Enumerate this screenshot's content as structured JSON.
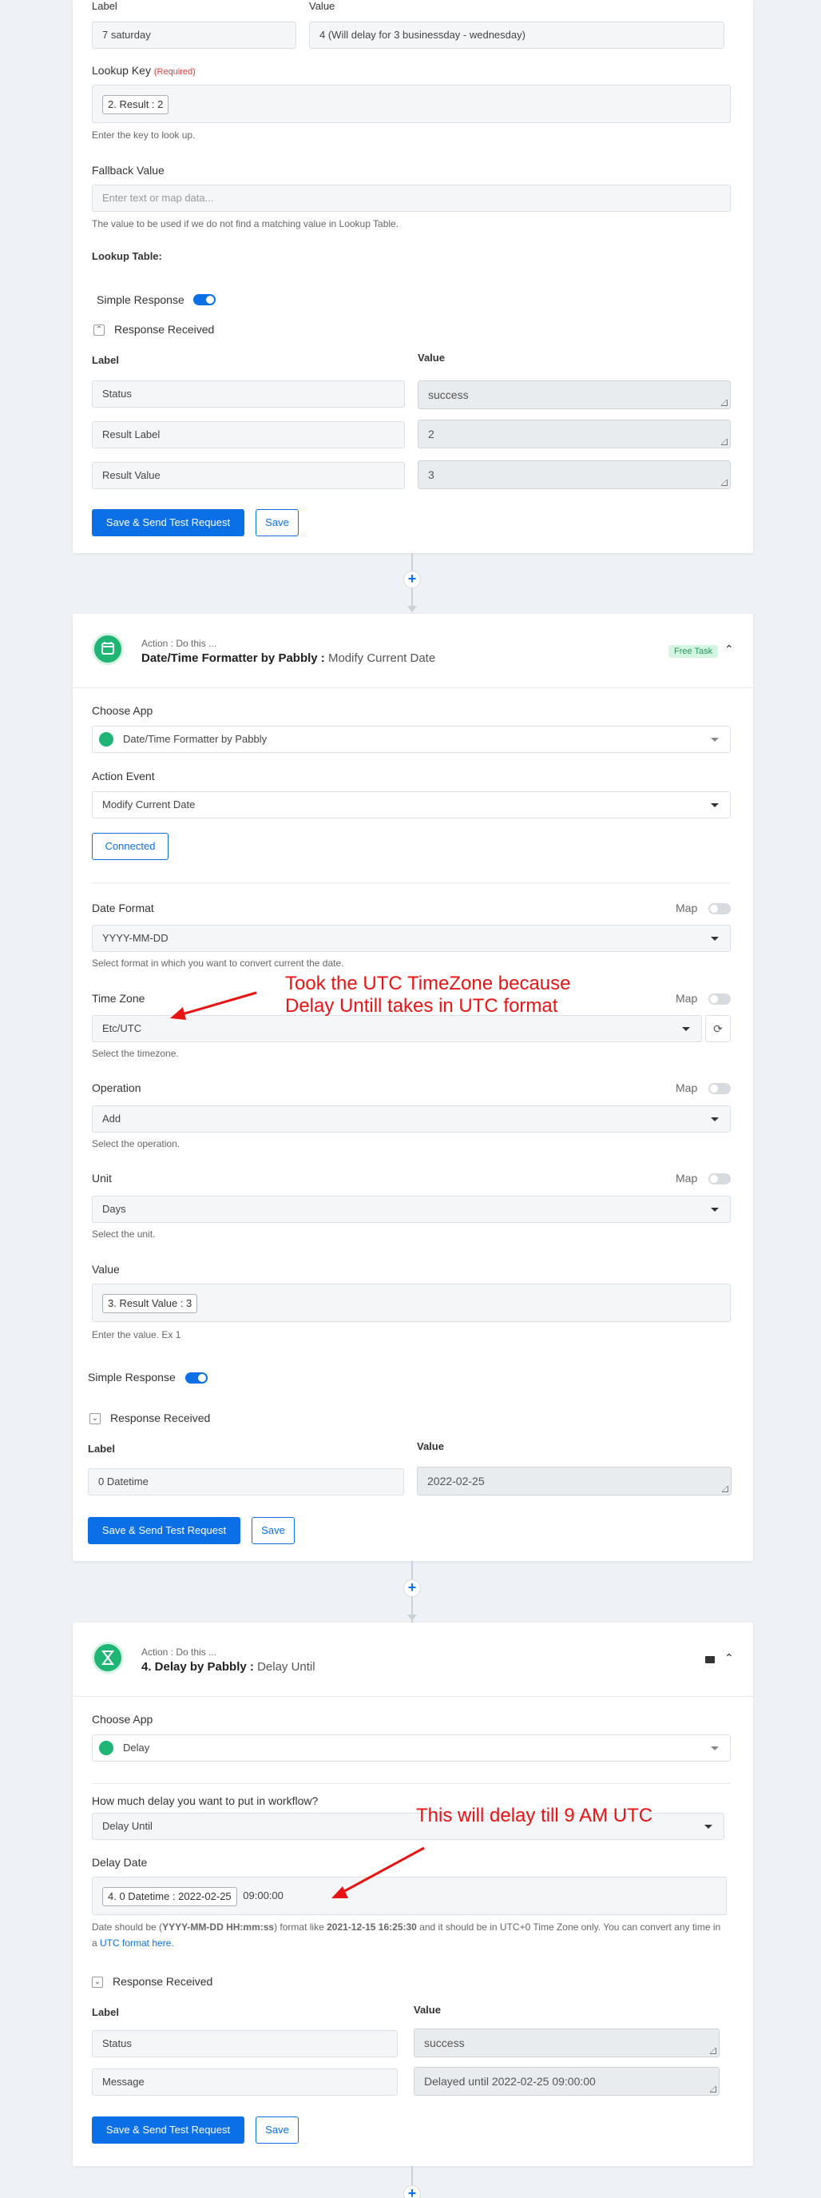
{
  "card1": {
    "label_header": "Label",
    "value_header": "Value",
    "row_label": "7 saturday",
    "row_value": "4 (Will delay for 3 businessday - wednesday)",
    "lookup_key_label": "Lookup Key",
    "required": "(Required)",
    "lookup_tag": "2. Result : 2",
    "lookup_help": "Enter the key to look up.",
    "fallback_label": "Fallback Value",
    "fallback_placeholder": "Enter text or map data...",
    "fallback_help": "The value to be used if we do not find a matching value in Lookup Table.",
    "lookup_table_label": "Lookup Table:",
    "simple_response": "Simple Response",
    "response_received": "Response Received",
    "resp_label_header": "Label",
    "resp_value_header": "Value",
    "responses": [
      {
        "label": "Status",
        "value": "success"
      },
      {
        "label": "Result Label",
        "value": "2"
      },
      {
        "label": "Result Value",
        "value": "3"
      }
    ],
    "save_send": "Save & Send Test Request",
    "save": "Save"
  },
  "card2": {
    "action_sub": "Action : Do this ...",
    "title_main": "Date/Time Formatter by Pabbly :",
    "title_event": "Modify Current Date",
    "badge": "Free Task",
    "choose_app_label": "Choose App",
    "choose_app_value": "Date/Time Formatter by Pabbly",
    "action_event_label": "Action Event",
    "action_event_value": "Modify Current Date",
    "connected": "Connected",
    "map": "Map",
    "date_format_label": "Date Format",
    "date_format_value": "YYYY-MM-DD",
    "date_format_help": "Select format in which you want to convert current the date.",
    "timezone_label": "Time Zone",
    "timezone_value": "Etc/UTC",
    "timezone_help": "Select the timezone.",
    "operation_label": "Operation",
    "operation_value": "Add",
    "operation_help": "Select the operation.",
    "unit_label": "Unit",
    "unit_value": "Days",
    "unit_help": "Select the unit.",
    "value_label": "Value",
    "value_tag": "3. Result Value : 3",
    "value_help": "Enter the value. Ex 1",
    "simple_response": "Simple Response",
    "response_received": "Response Received",
    "resp_label_header": "Label",
    "resp_value_header": "Value",
    "resp_label": "0 Datetime",
    "resp_value": "2022-02-25",
    "save_send": "Save & Send Test Request",
    "save": "Save"
  },
  "card3": {
    "action_sub": "Action : Do this ...",
    "title_main": "4. Delay by Pabbly :",
    "title_event": "Delay Until",
    "choose_app_label": "Choose App",
    "choose_app_value": "Delay",
    "how_much_label": "How much delay you want to put in workflow?",
    "delay_type_value": "Delay Until",
    "delay_date_label": "Delay Date",
    "delay_tag": "4. 0 Datetime : 2022-02-25",
    "delay_time": "09:00:00",
    "help_pre": "Date should be (",
    "help_format": "YYYY-MM-DD HH:mm:ss",
    "help_mid": ") format like ",
    "help_example": "2021-12-15 16:25:30",
    "help_post": " and it should be in UTC+0 Time Zone only. You can convert any time in a ",
    "help_link": "UTC format here.",
    "response_received": "Response Received",
    "resp_label_header": "Label",
    "resp_value_header": "Value",
    "responses": [
      {
        "label": "Status",
        "value": "success"
      },
      {
        "label": "Message",
        "value": "Delayed until 2022-02-25 09:00:00"
      }
    ],
    "save_send": "Save & Send Test Request",
    "save": "Save"
  },
  "annotations": {
    "timezone_line1": "Took the UTC TimeZone because",
    "timezone_line2": "Delay Untill takes in UTC format",
    "delay_note": "This will delay till 9 AM UTC"
  },
  "colors": {
    "primary": "#0b70e6",
    "app_green": "#1fb574",
    "annotation_red": "#e81313"
  }
}
